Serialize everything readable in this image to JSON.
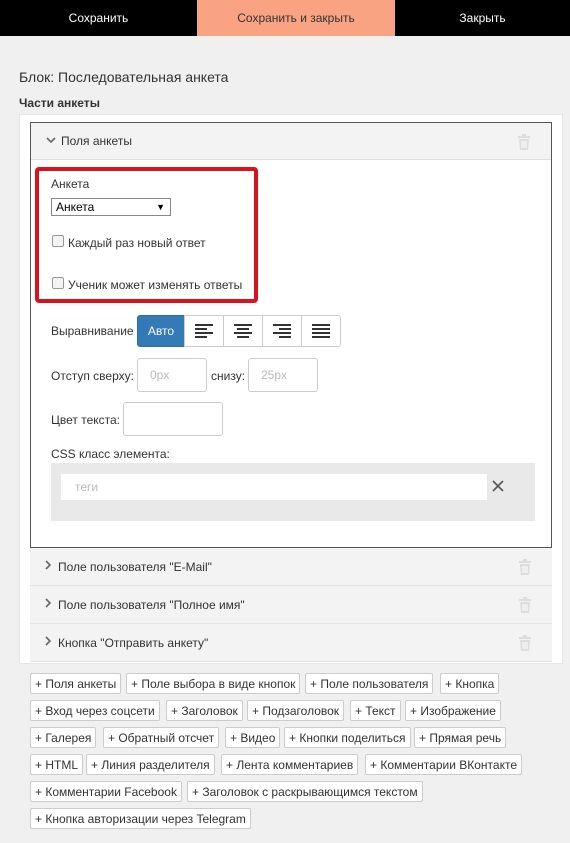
{
  "toolbar": {
    "save_label": "Сохранить",
    "save_close_label": "Сохранить и закрыть",
    "close_label": "Закрыть"
  },
  "block_title": "Блок: Последовательная анкета",
  "parts_title": "Части анкеты",
  "panel_open": {
    "title": "Поля анкеты",
    "survey_label": "Анкета",
    "survey_select_value": "Анкета",
    "checkbox_new_answer": "Каждый раз новый ответ",
    "checkbox_new_answer_checked": false,
    "checkbox_can_edit": "Ученик может изменять ответы",
    "checkbox_can_edit_checked": false,
    "align_label": "Выравнивание",
    "align_auto_label": "Авто",
    "align_selected": "Авто",
    "margin_top_label": "Отступ сверху:",
    "margin_top_placeholder": "0px",
    "margin_bottom_label": "снизу:",
    "margin_bottom_placeholder": "25px",
    "text_color_label": "Цвет текста:",
    "css_class_label": "CSS класс элемента:",
    "tags_placeholder": "теги"
  },
  "collapsed_panels": [
    "Поле пользователя \"E-Mail\"",
    "Поле пользователя \"Полное имя\"",
    "Кнопка \"Отправить анкету\""
  ],
  "add_buttons": [
    "+ Поля анкеты",
    "+ Поле выбора в виде кнопок",
    "+ Поле пользователя",
    "+ Кнопка",
    "+ Вход через соцсети",
    "+ Заголовок",
    "+ Подзаголовок",
    "+ Текст",
    "+ Изображение",
    "+ Галерея",
    "+ Обратный отсчет",
    "+ Видео",
    "+ Кнопки поделиться",
    "+ Прямая речь",
    "+ HTML",
    "+ Линия разделителя",
    "+ Лента комментариев",
    "+ Комментарии ВКонтакте",
    "+ Комментарии Facebook",
    "+ Заголовок с раскрывающимся текстом",
    "+ Кнопка авторизации через Telegram"
  ],
  "colors": {
    "primary_bar": "#000000",
    "accent_bar": "#f9a382",
    "active_button": "#337ab7",
    "highlight_box": "#d9121b"
  },
  "icons": {
    "trash": "trash-icon",
    "chevron_down": "chevron-down-icon",
    "chevron_right": "chevron-right-icon",
    "close": "close-icon"
  }
}
